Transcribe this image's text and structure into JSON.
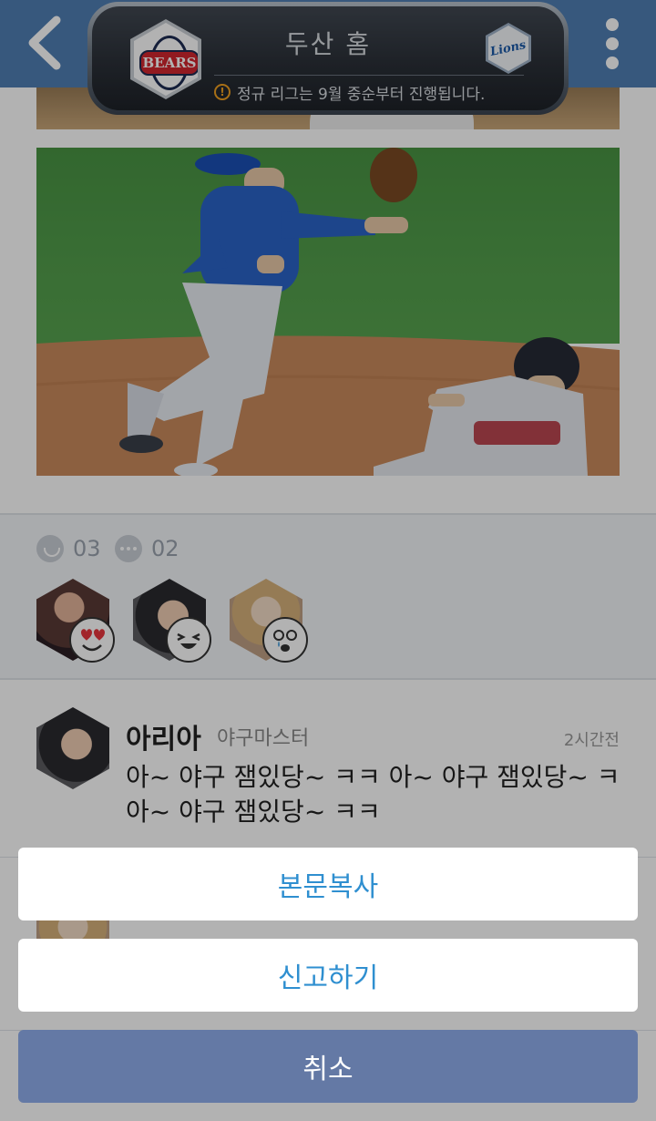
{
  "header": {
    "title": "두산 홈",
    "notice": "정규 리그는 9월 중순부터 진행됩니다.",
    "notice_icon": "!",
    "home_logo_text": "BEARS",
    "away_logo_text": "Lions",
    "bar_color": "#4f7eb3"
  },
  "post": {
    "stats": {
      "likes": "03",
      "comments": "02"
    },
    "reactors": [
      {
        "emoji": "heart-eyes-emoji-icon"
      },
      {
        "emoji": "laughing-emoji-icon"
      },
      {
        "emoji": "teary-emoji-icon"
      }
    ]
  },
  "comments": [
    {
      "name": "아리아",
      "title": "야구마스터",
      "time": "2시간전",
      "text": "아~ 야구 잼있당~ ㅋㅋ 아~ 야구 잼있당~ ㅋ 아~ 야구 잼있당~ ㅋㅋ"
    }
  ],
  "action_sheet": {
    "copy_label": "본문복사",
    "report_label": "신고하기",
    "cancel_label": "취소",
    "accent_color": "#2f8fd0",
    "cancel_color": "#6479a5"
  }
}
